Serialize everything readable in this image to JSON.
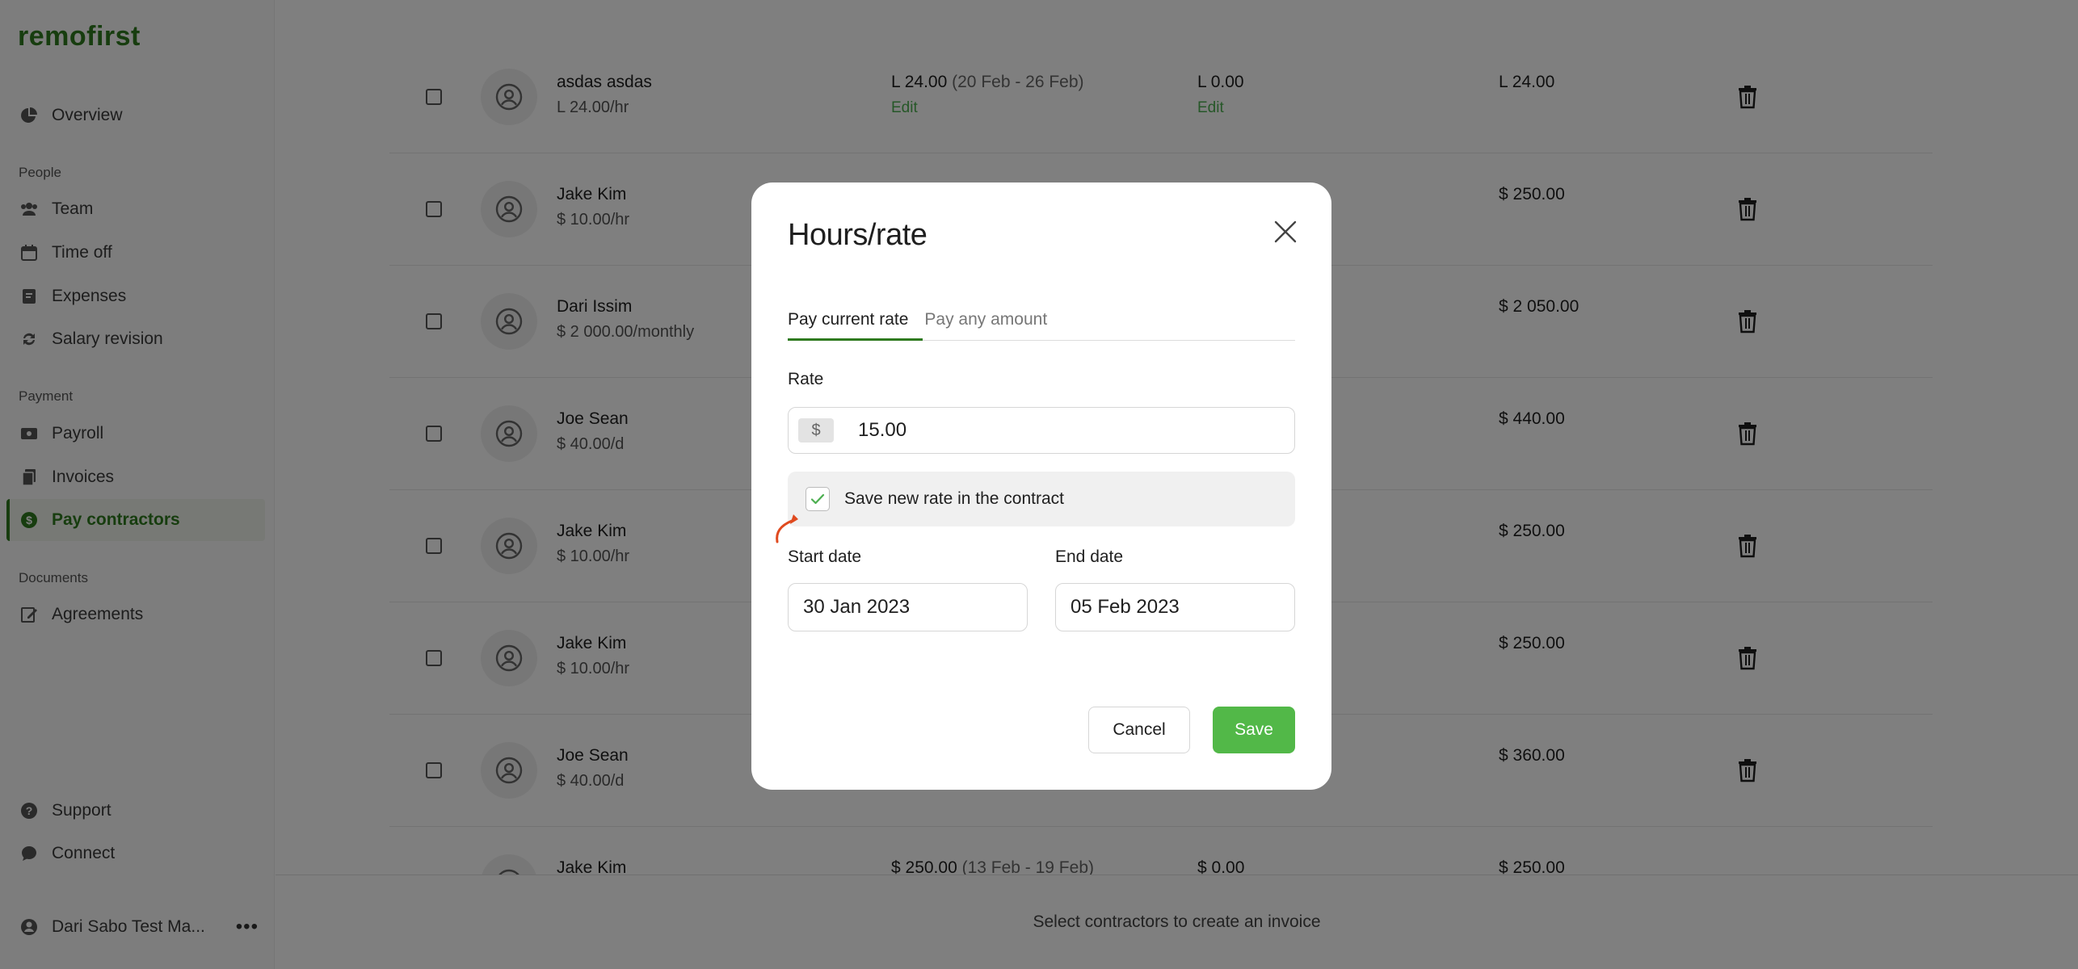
{
  "app": {
    "logo": "remofirst"
  },
  "sidebar": {
    "overview": "Overview",
    "sections": {
      "people": "People",
      "payment": "Payment",
      "documents": "Documents"
    },
    "items": {
      "team": "Team",
      "time_off": "Time off",
      "expenses": "Expenses",
      "salary_revision": "Salary revision",
      "payroll": "Payroll",
      "invoices": "Invoices",
      "pay_contractors": "Pay contractors",
      "agreements": "Agreements",
      "support": "Support",
      "connect": "Connect"
    },
    "user": {
      "name": "Dari Sabo Test Ma...",
      "more": "•••"
    },
    "accent_color": "#2f7a1f"
  },
  "table": {
    "rows": [
      {
        "name": "asdas asdas",
        "rate": "L 24.00/hr",
        "amount": "L 24.00",
        "period": " (20 Feb - 26 Feb)",
        "edit_amount": "Edit",
        "extra": "L 0.00",
        "edit_extra": "Edit",
        "total": "L 24.00"
      },
      {
        "name": "Jake Kim",
        "rate": "$ 10.00/hr",
        "total": "$ 250.00"
      },
      {
        "name": "Dari Issim",
        "rate": "$ 2 000.00/monthly",
        "total": "$ 2 050.00"
      },
      {
        "name": "Joe Sean",
        "rate": "$ 40.00/d",
        "total": "$ 440.00"
      },
      {
        "name": "Jake Kim",
        "rate": "$ 10.00/hr",
        "total": "$ 250.00"
      },
      {
        "name": "Jake Kim",
        "rate": "$ 10.00/hr",
        "total": "$ 250.00"
      },
      {
        "name": "Joe Sean",
        "rate": "$ 40.00/d",
        "total": "$ 360.00"
      },
      {
        "name": "Jake Kim",
        "amount": "$ 250.00",
        "period": " (13 Feb - 19 Feb)",
        "extra": "$ 0.00",
        "total": "$ 250.00"
      }
    ]
  },
  "footer": {
    "hint": "Select contractors to create an invoice"
  },
  "modal": {
    "title": "Hours/rate",
    "tabs": [
      {
        "label": "Pay current rate"
      },
      {
        "label": "Pay any amount"
      }
    ],
    "rate": {
      "label": "Rate",
      "currency": "$",
      "value": "15.00"
    },
    "save_new_rate": {
      "label": "Save new rate in the contract",
      "checked": true
    },
    "start_date": {
      "label": "Start date",
      "value": "30 Jan 2023"
    },
    "end_date": {
      "label": "End date",
      "value": "05 Feb 2023"
    },
    "cancel_label": "Cancel",
    "save_label": "Save",
    "save_color": "#52b848"
  }
}
